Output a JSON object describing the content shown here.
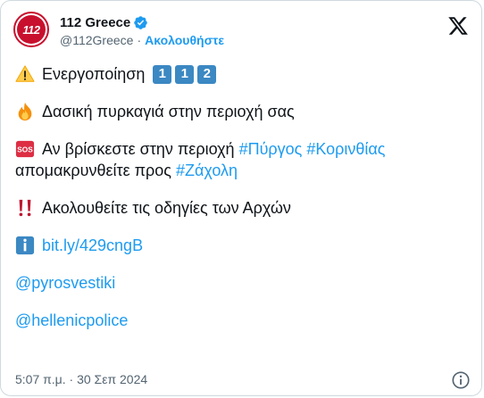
{
  "account": {
    "display_name": "112 Greece",
    "handle": "@112Greece",
    "separator": "·",
    "follow_label": "Ακολουθήστε",
    "avatar_text": "112"
  },
  "tweet": {
    "line1_text": "Ενεργοποίηση",
    "keycaps": [
      "1",
      "1",
      "2"
    ],
    "line2_text": "Δασική πυρκαγιά στην περιοχή σας",
    "line3_text": "Αν βρίσκεστε στην περιοχή",
    "hashtag_pyrgos": "#Πύργος",
    "hashtag_korinthias": "#Κορινθίας",
    "line3b_text": "απομακρυνθείτε προς",
    "hashtag_zacholi": "#Ζάχολη",
    "line4_text": "Ακολουθείτε τις οδηγίες των Αρχών",
    "link_url": "bit.ly/429cngB",
    "mention_1": "@pyrosvestiki",
    "mention_2": "@hellenicpolice"
  },
  "footer": {
    "timestamp": "5:07 π.μ. · 30 Σεπ 2024"
  },
  "icons": {
    "warning": "warning-icon",
    "fire": "fire-icon",
    "sos": "sos-icon",
    "double_exclamation": "double-exclamation-icon",
    "info": "info-icon",
    "x_logo": "x-logo-icon",
    "verified": "verified-badge-icon"
  },
  "colors": {
    "link": "#1d9bf0",
    "text": "#0f1419",
    "secondary": "#536471",
    "brand_red": "#c8102e",
    "keycap_blue": "#3b88c3"
  }
}
